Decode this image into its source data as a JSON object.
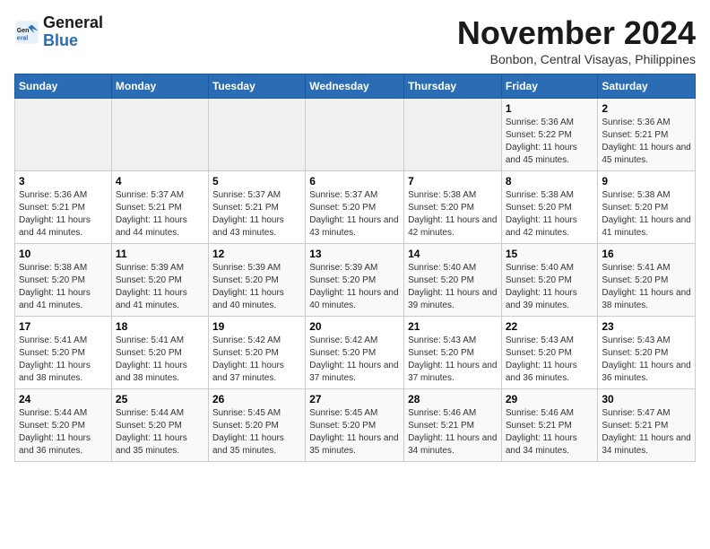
{
  "logo": {
    "text_general": "General",
    "text_blue": "Blue"
  },
  "header": {
    "month": "November 2024",
    "location": "Bonbon, Central Visayas, Philippines"
  },
  "weekdays": [
    "Sunday",
    "Monday",
    "Tuesday",
    "Wednesday",
    "Thursday",
    "Friday",
    "Saturday"
  ],
  "weeks": [
    [
      {
        "day": "",
        "info": ""
      },
      {
        "day": "",
        "info": ""
      },
      {
        "day": "",
        "info": ""
      },
      {
        "day": "",
        "info": ""
      },
      {
        "day": "",
        "info": ""
      },
      {
        "day": "1",
        "info": "Sunrise: 5:36 AM\nSunset: 5:22 PM\nDaylight: 11 hours and 45 minutes."
      },
      {
        "day": "2",
        "info": "Sunrise: 5:36 AM\nSunset: 5:21 PM\nDaylight: 11 hours and 45 minutes."
      }
    ],
    [
      {
        "day": "3",
        "info": "Sunrise: 5:36 AM\nSunset: 5:21 PM\nDaylight: 11 hours and 44 minutes."
      },
      {
        "day": "4",
        "info": "Sunrise: 5:37 AM\nSunset: 5:21 PM\nDaylight: 11 hours and 44 minutes."
      },
      {
        "day": "5",
        "info": "Sunrise: 5:37 AM\nSunset: 5:21 PM\nDaylight: 11 hours and 43 minutes."
      },
      {
        "day": "6",
        "info": "Sunrise: 5:37 AM\nSunset: 5:20 PM\nDaylight: 11 hours and 43 minutes."
      },
      {
        "day": "7",
        "info": "Sunrise: 5:38 AM\nSunset: 5:20 PM\nDaylight: 11 hours and 42 minutes."
      },
      {
        "day": "8",
        "info": "Sunrise: 5:38 AM\nSunset: 5:20 PM\nDaylight: 11 hours and 42 minutes."
      },
      {
        "day": "9",
        "info": "Sunrise: 5:38 AM\nSunset: 5:20 PM\nDaylight: 11 hours and 41 minutes."
      }
    ],
    [
      {
        "day": "10",
        "info": "Sunrise: 5:38 AM\nSunset: 5:20 PM\nDaylight: 11 hours and 41 minutes."
      },
      {
        "day": "11",
        "info": "Sunrise: 5:39 AM\nSunset: 5:20 PM\nDaylight: 11 hours and 41 minutes."
      },
      {
        "day": "12",
        "info": "Sunrise: 5:39 AM\nSunset: 5:20 PM\nDaylight: 11 hours and 40 minutes."
      },
      {
        "day": "13",
        "info": "Sunrise: 5:39 AM\nSunset: 5:20 PM\nDaylight: 11 hours and 40 minutes."
      },
      {
        "day": "14",
        "info": "Sunrise: 5:40 AM\nSunset: 5:20 PM\nDaylight: 11 hours and 39 minutes."
      },
      {
        "day": "15",
        "info": "Sunrise: 5:40 AM\nSunset: 5:20 PM\nDaylight: 11 hours and 39 minutes."
      },
      {
        "day": "16",
        "info": "Sunrise: 5:41 AM\nSunset: 5:20 PM\nDaylight: 11 hours and 38 minutes."
      }
    ],
    [
      {
        "day": "17",
        "info": "Sunrise: 5:41 AM\nSunset: 5:20 PM\nDaylight: 11 hours and 38 minutes."
      },
      {
        "day": "18",
        "info": "Sunrise: 5:41 AM\nSunset: 5:20 PM\nDaylight: 11 hours and 38 minutes."
      },
      {
        "day": "19",
        "info": "Sunrise: 5:42 AM\nSunset: 5:20 PM\nDaylight: 11 hours and 37 minutes."
      },
      {
        "day": "20",
        "info": "Sunrise: 5:42 AM\nSunset: 5:20 PM\nDaylight: 11 hours and 37 minutes."
      },
      {
        "day": "21",
        "info": "Sunrise: 5:43 AM\nSunset: 5:20 PM\nDaylight: 11 hours and 37 minutes."
      },
      {
        "day": "22",
        "info": "Sunrise: 5:43 AM\nSunset: 5:20 PM\nDaylight: 11 hours and 36 minutes."
      },
      {
        "day": "23",
        "info": "Sunrise: 5:43 AM\nSunset: 5:20 PM\nDaylight: 11 hours and 36 minutes."
      }
    ],
    [
      {
        "day": "24",
        "info": "Sunrise: 5:44 AM\nSunset: 5:20 PM\nDaylight: 11 hours and 36 minutes."
      },
      {
        "day": "25",
        "info": "Sunrise: 5:44 AM\nSunset: 5:20 PM\nDaylight: 11 hours and 35 minutes."
      },
      {
        "day": "26",
        "info": "Sunrise: 5:45 AM\nSunset: 5:20 PM\nDaylight: 11 hours and 35 minutes."
      },
      {
        "day": "27",
        "info": "Sunrise: 5:45 AM\nSunset: 5:20 PM\nDaylight: 11 hours and 35 minutes."
      },
      {
        "day": "28",
        "info": "Sunrise: 5:46 AM\nSunset: 5:21 PM\nDaylight: 11 hours and 34 minutes."
      },
      {
        "day": "29",
        "info": "Sunrise: 5:46 AM\nSunset: 5:21 PM\nDaylight: 11 hours and 34 minutes."
      },
      {
        "day": "30",
        "info": "Sunrise: 5:47 AM\nSunset: 5:21 PM\nDaylight: 11 hours and 34 minutes."
      }
    ]
  ]
}
